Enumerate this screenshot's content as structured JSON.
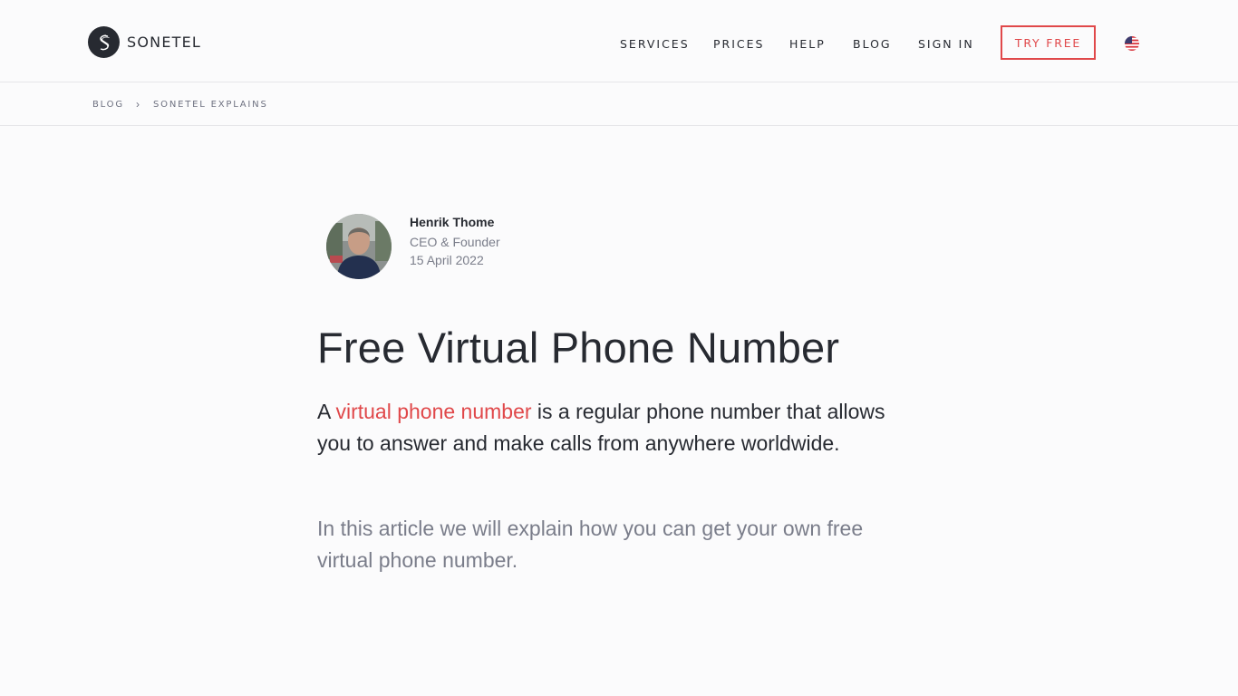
{
  "brand": {
    "name": "SONETEL",
    "accent_color": "#e0484a",
    "text_color": "#272a31"
  },
  "nav": {
    "items": [
      "SERVICES",
      "PRICES",
      "HELP",
      "BLOG",
      "SIGN IN"
    ],
    "cta_label": "TRY FREE",
    "language_icon": "us-flag-icon"
  },
  "breadcrumb": {
    "items": [
      "BLOG",
      "SONETEL EXPLAINS"
    ],
    "separator": "›"
  },
  "article": {
    "author": {
      "name": "Henrik Thome",
      "role": "CEO & Founder",
      "date": "15 April 2022"
    },
    "title": "Free Virtual Phone Number",
    "lead": {
      "prefix": "A ",
      "link_text": "virtual phone number",
      "suffix": " is a regular phone number that allows you to answer and make calls from anywhere worldwide."
    },
    "intro": "In this article we will explain how you can get your own free virtual phone number."
  }
}
